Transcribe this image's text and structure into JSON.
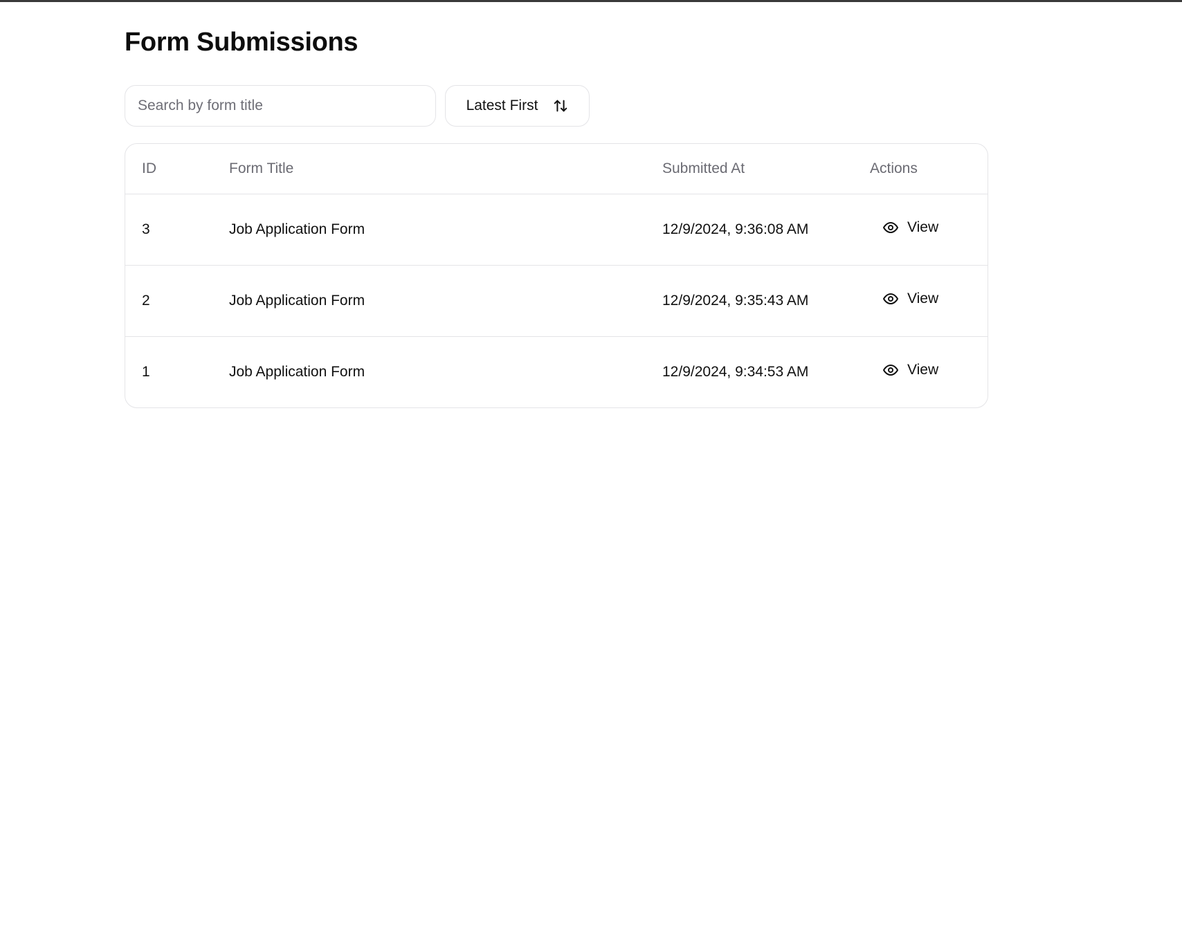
{
  "page": {
    "title": "Form Submissions"
  },
  "search": {
    "placeholder": "Search by form title",
    "value": ""
  },
  "sort": {
    "label": "Latest First",
    "icon": "sort-arrows-icon"
  },
  "table": {
    "columns": [
      "ID",
      "Form Title",
      "Submitted At",
      "Actions"
    ],
    "rows": [
      {
        "id": "3",
        "title": "Job Application Form",
        "submitted_at": "12/9/2024, 9:36:08 AM",
        "action_label": "View",
        "action_icon": "eye-icon"
      },
      {
        "id": "2",
        "title": "Job Application Form",
        "submitted_at": "12/9/2024, 9:35:43 AM",
        "action_label": "View",
        "action_icon": "eye-icon"
      },
      {
        "id": "1",
        "title": "Job Application Form",
        "submitted_at": "12/9/2024, 9:34:53 AM",
        "action_label": "View",
        "action_icon": "eye-icon"
      }
    ]
  },
  "colors": {
    "border": "#e4e4e7",
    "header_text": "#6b6b73",
    "text": "#111111",
    "top_bar": "#3a3a3a"
  }
}
